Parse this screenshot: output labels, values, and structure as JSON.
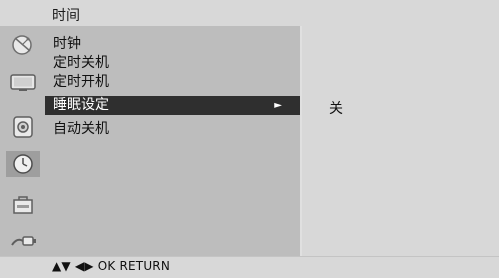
{
  "header": {
    "title": "时间"
  },
  "menu": {
    "items": [
      {
        "label": "时钟"
      },
      {
        "label": "定时关机"
      },
      {
        "label": "定时开机"
      },
      {
        "label": "睡眠设定",
        "selected": true
      },
      {
        "label": "自动关机"
      }
    ],
    "selected_arrow": "►"
  },
  "value_panel": {
    "value": "关"
  },
  "footer": {
    "hint": "▲▼ ◀▶ OK  RETURN"
  },
  "sidebar_icons": [
    "satellite-dish-icon",
    "monitor-icon",
    "speaker-icon",
    "clock-icon",
    "lock-icon",
    "input-cable-icon"
  ],
  "colors": {
    "selected_bg": "#2f2f2f",
    "panel_bg": "#bdbdbd",
    "page_bg": "#d8d8d8"
  }
}
